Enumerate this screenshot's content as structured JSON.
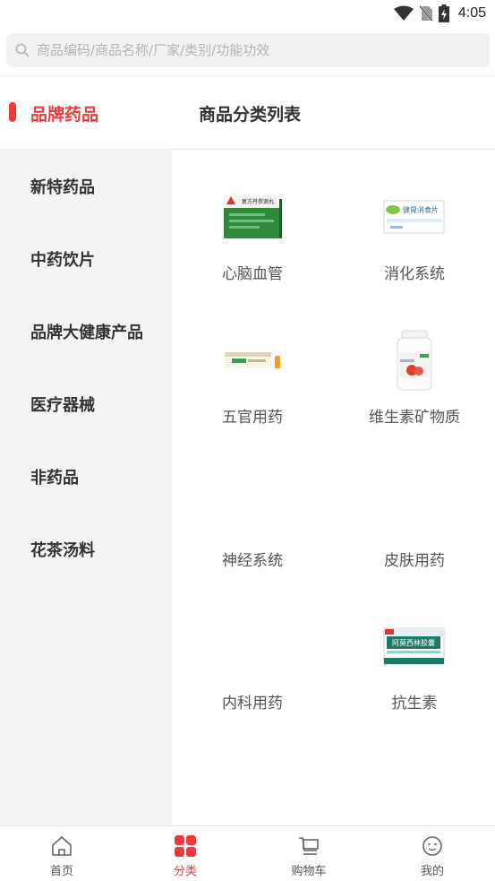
{
  "status_bar": {
    "time": "4:05",
    "icons": [
      "wifi-icon",
      "no-sim-icon",
      "battery-charging-icon"
    ]
  },
  "search": {
    "placeholder": "商品编码/商品名称/厂家/类别/功能功效"
  },
  "brand_tab": {
    "label": "品牌药品"
  },
  "list_title": "商品分类列表",
  "sidebar": {
    "items": [
      {
        "label": "新特药品"
      },
      {
        "label": "中药饮片"
      },
      {
        "label": "品牌大健康产品"
      },
      {
        "label": "医疗器械"
      },
      {
        "label": "非药品"
      },
      {
        "label": "花茶汤料"
      }
    ]
  },
  "categories": [
    {
      "name": "心脑血管",
      "image": "product-box-green",
      "image_text": "复方丹参滴丸"
    },
    {
      "name": "消化系统",
      "image": "product-box-white",
      "image_text": "健胃消食片"
    },
    {
      "name": "五官用药",
      "image": "product-strip",
      "image_text": ""
    },
    {
      "name": "维生素矿物质",
      "image": "product-bottle",
      "image_text": ""
    },
    {
      "name": "神经系统",
      "image": "none"
    },
    {
      "name": "皮肤用药",
      "image": "none"
    },
    {
      "name": "内科用药",
      "image": "none"
    },
    {
      "name": "抗生素",
      "image": "product-box-teal",
      "image_text": "阿莫西林胶囊"
    }
  ],
  "tabbar": {
    "items": [
      {
        "label": "首页",
        "icon": "home-icon",
        "active": false
      },
      {
        "label": "分类",
        "icon": "category-grid-icon",
        "active": true
      },
      {
        "label": "购物车",
        "icon": "cart-icon",
        "active": false
      },
      {
        "label": "我的",
        "icon": "profile-icon",
        "active": false
      }
    ]
  },
  "colors": {
    "accent": "#ee3a3a",
    "sidebar_bg": "#f4f4f4",
    "text": "#333333"
  }
}
